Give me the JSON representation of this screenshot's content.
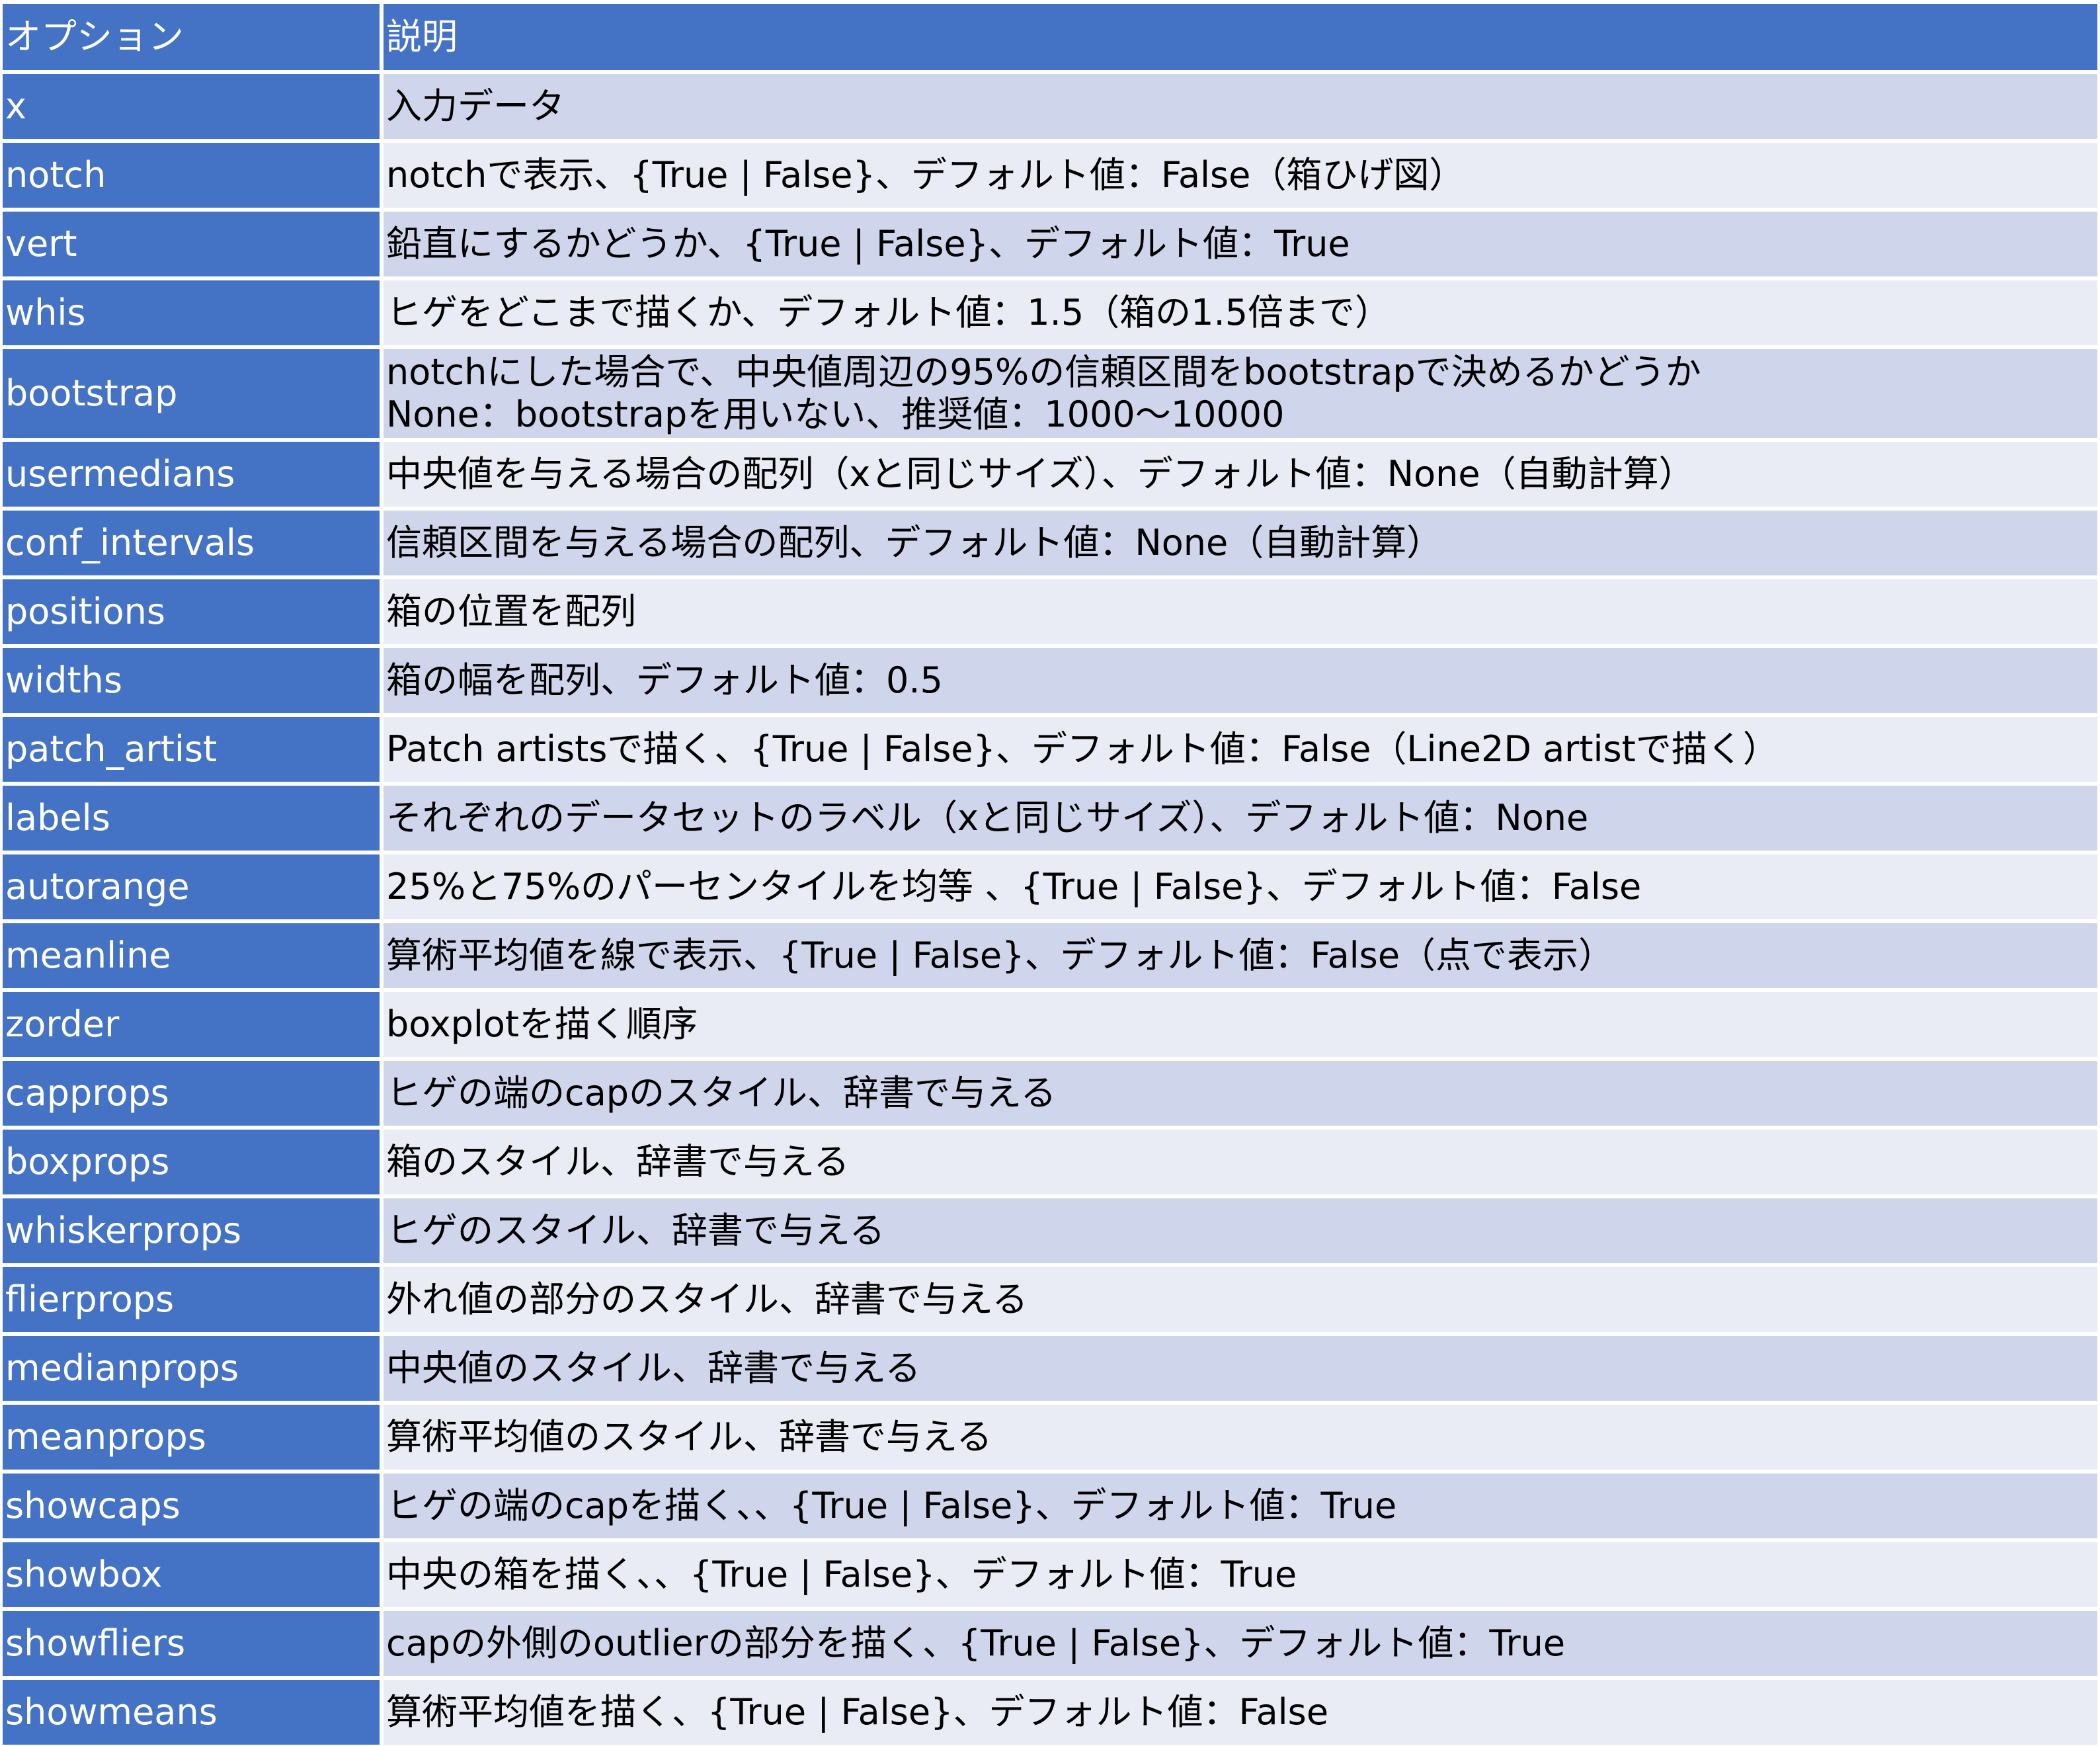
{
  "colors": {
    "header_bg": "#4472c4",
    "odd_row_bg": "#cfd5ea",
    "even_row_bg": "#e9ebf5",
    "header_text": "#ffffff",
    "body_text": "#000000"
  },
  "table": {
    "headers": [
      "オプション",
      "説明"
    ],
    "rows": [
      {
        "option": "x",
        "description": [
          "入力データ"
        ]
      },
      {
        "option": "notch",
        "description": [
          "notchで表示、{True | False}、デフォルト値：False（箱ひげ図）"
        ]
      },
      {
        "option": "vert",
        "description": [
          "鉛直にするかどうか、{True | False}、デフォルト値：True"
        ]
      },
      {
        "option": "whis",
        "description": [
          "ヒゲをどこまで描くか、デフォルト値：1.5（箱の1.5倍まで）"
        ]
      },
      {
        "option": "bootstrap",
        "description": [
          "notchにした場合で、中央値周辺の95%の信頼区間をbootstrapで決めるかどうか",
          "None：bootstrapを用いない、推奨値：1000〜10000"
        ]
      },
      {
        "option": "usermedians",
        "description": [
          "中央値を与える場合の配列（xと同じサイズ）、デフォルト値：None（自動計算）"
        ]
      },
      {
        "option": "conf_intervals",
        "description": [
          "信頼区間を与える場合の配列、デフォルト値：None（自動計算）"
        ]
      },
      {
        "option": "positions",
        "description": [
          "箱の位置を配列"
        ]
      },
      {
        "option": "widths",
        "description": [
          "箱の幅を配列、デフォルト値：0.5"
        ]
      },
      {
        "option": "patch_artist",
        "description": [
          "Patch artistsで描く、{True | False}、デフォルト値：False（Line2D artistで描く）"
        ]
      },
      {
        "option": "labels",
        "description": [
          "それぞれのデータセットのラベル（xと同じサイズ）、デフォルト値：None"
        ]
      },
      {
        "option": "autorange",
        "description": [
          "25%と75%のパーセンタイルを均等 、{True | False}、デフォルト値：False"
        ]
      },
      {
        "option": "meanline",
        "description": [
          "算術平均値を線で表示、{True | False}、デフォルト値：False（点で表示）"
        ]
      },
      {
        "option": "zorder",
        "description": [
          "boxplotを描く順序"
        ]
      },
      {
        "option": "capprops",
        "description": [
          "ヒゲの端のcapのスタイル、辞書で与える"
        ]
      },
      {
        "option": "boxprops",
        "description": [
          "箱のスタイル、辞書で与える"
        ]
      },
      {
        "option": "whiskerprops",
        "description": [
          "ヒゲのスタイル、辞書で与える"
        ]
      },
      {
        "option": "flierprops",
        "description": [
          "外れ値の部分のスタイル、辞書で与える"
        ]
      },
      {
        "option": "medianprops",
        "description": [
          "中央値のスタイル、辞書で与える"
        ]
      },
      {
        "option": "meanprops",
        "description": [
          "算術平均値のスタイル、辞書で与える"
        ]
      },
      {
        "option": "showcaps",
        "description": [
          "ヒゲの端のcapを描く、、{True | False}、デフォルト値：True"
        ]
      },
      {
        "option": "showbox",
        "description": [
          "中央の箱を描く、、{True | False}、デフォルト値：True"
        ]
      },
      {
        "option": "showfliers",
        "description": [
          "capの外側のoutlierの部分を描く、{True | False}、デフォルト値：True"
        ]
      },
      {
        "option": "showmeans",
        "description": [
          "算術平均値を描く、{True | False}、デフォルト値：False"
        ]
      }
    ]
  }
}
